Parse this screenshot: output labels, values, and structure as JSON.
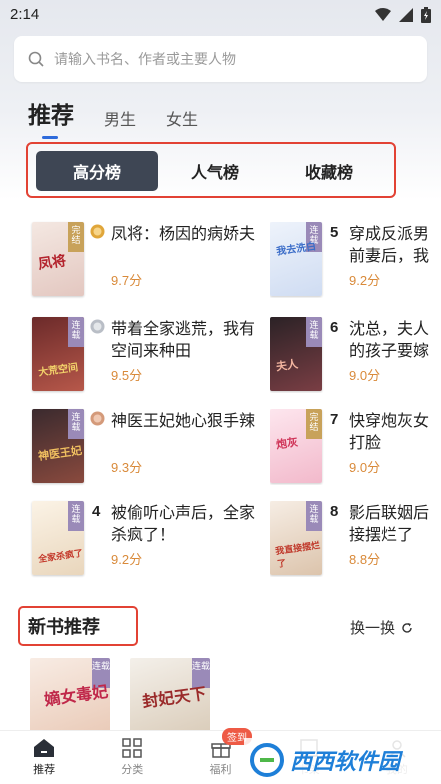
{
  "status_bar": {
    "time": "2:14"
  },
  "search": {
    "placeholder": "请输入书名、作者或主要人物"
  },
  "top_tabs": [
    {
      "label": "推荐",
      "active": true
    },
    {
      "label": "男生",
      "active": false
    },
    {
      "label": "女生",
      "active": false
    }
  ],
  "rank_tabs": [
    {
      "label": "高分榜",
      "active": true
    },
    {
      "label": "人气榜",
      "active": false
    },
    {
      "label": "收藏榜",
      "active": false
    }
  ],
  "rank_books": [
    {
      "rank": "1",
      "title": "凤将：杨因的病娇夫",
      "score": "9.7分",
      "tag": "完结",
      "cover_text": "凤将"
    },
    {
      "rank": "2",
      "title": "带着全家逃荒，我有空间来种田",
      "score": "9.5分",
      "tag": "连载",
      "cover_text": "大荒空间"
    },
    {
      "rank": "3",
      "title": "神医王妃她心狠手辣",
      "score": "9.3分",
      "tag": "连载",
      "cover_text": "神医王妃"
    },
    {
      "rank": "4",
      "title": "被偷听心声后，全家杀疯了！",
      "score": "9.2分",
      "tag": "连载",
      "cover_text": "全家杀疯了"
    },
    {
      "rank": "5",
      "title": "穿成反派男前妻后，我",
      "score": "9.2分",
      "tag": "连载",
      "cover_text": "我去洗白"
    },
    {
      "rank": "6",
      "title": "沈总，夫人的孩子要嫁",
      "score": "9.0分",
      "tag": "连载",
      "cover_text": "夫人"
    },
    {
      "rank": "7",
      "title": "快穿炮灰女打脸",
      "score": "9.0分",
      "tag": "完结",
      "cover_text": "炮灰"
    },
    {
      "rank": "8",
      "title": "影后联姻后接摆烂了",
      "score": "8.8分",
      "tag": "连载",
      "cover_text": "我直接摆烂了"
    }
  ],
  "new_books": {
    "title": "新书推荐",
    "refresh_label": "换一换",
    "covers": [
      {
        "tag": "连载",
        "cover_text": "嫡女毒妃"
      },
      {
        "tag": "连载",
        "cover_text": "封妃天下"
      }
    ]
  },
  "bottom_nav": [
    {
      "label": "推荐",
      "icon": "home-icon",
      "active": true
    },
    {
      "label": "分类",
      "icon": "category-grid-icon",
      "active": false
    },
    {
      "label": "福利",
      "icon": "gift-icon",
      "active": false
    },
    {
      "label": "书架",
      "icon": "bookshelf-icon",
      "active": false
    },
    {
      "label": "我的",
      "icon": "profile-icon",
      "active": false
    }
  ],
  "welfare_badge": "签到",
  "watermark": {
    "text": "西西软件园"
  },
  "colors": {
    "accent_blue": "#2e6bdb",
    "active_tab_bg": "#3e4654",
    "highlight_border": "#e24234",
    "score_orange": "#d98a3a",
    "gold_medal": "#e0a63a",
    "silver_medal": "#b9bec6",
    "bronze_medal": "#d49a7a"
  }
}
